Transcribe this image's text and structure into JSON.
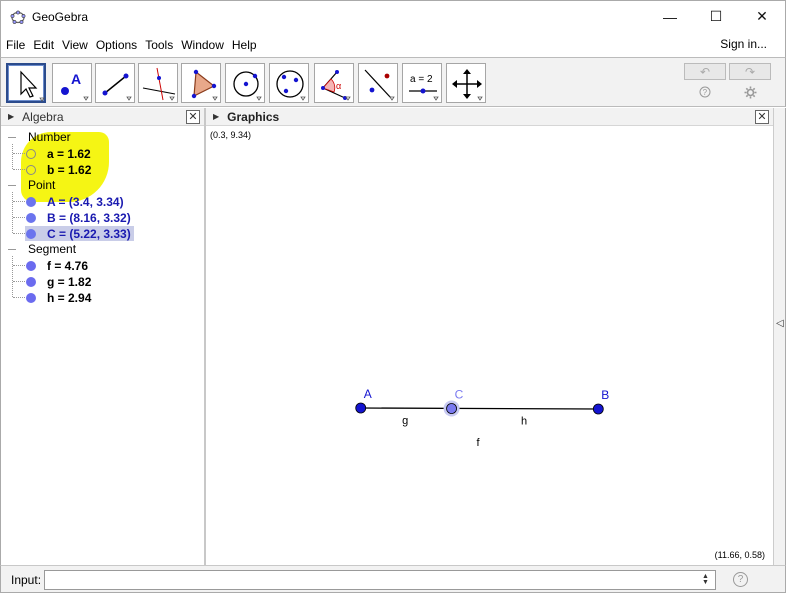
{
  "window": {
    "title": "GeoGebra",
    "minimize": "—",
    "maximize": "☐",
    "close": "✕"
  },
  "menu": {
    "items": [
      "File",
      "Edit",
      "View",
      "Options",
      "Tools",
      "Window",
      "Help"
    ],
    "signin": "Sign in..."
  },
  "toolbar": {
    "tools": [
      "move-tool",
      "point-tool",
      "segment-tool",
      "perpendicular-line-tool",
      "polygon-tool",
      "circle-center-point-tool",
      "circle-three-points-tool",
      "angle-tool",
      "reflect-tool",
      "slider-tool",
      "move-graphics-view-tool"
    ],
    "slider_label": "a = 2",
    "undo": "↶",
    "redo": "↷"
  },
  "algebra": {
    "title": "Algebra",
    "groups": [
      {
        "label": "Number",
        "items": [
          "a = 1.62",
          "b = 1.62"
        ]
      },
      {
        "label": "Point",
        "items": [
          "A = (3.4, 3.34)",
          "B = (8.16, 3.32)",
          "C = (5.22, 3.33)"
        ]
      },
      {
        "label": "Segment",
        "items": [
          "f = 4.76",
          "g = 1.82",
          "h = 2.94"
        ]
      }
    ]
  },
  "graphics": {
    "title": "Graphics",
    "corner_top_left": "(0.3, 9.34)",
    "corner_bottom_right": "(11.66, 0.58)",
    "points": [
      {
        "label": "A",
        "x": 3.4,
        "y": 3.34,
        "color": "#1414d0"
      },
      {
        "label": "C",
        "x": 5.22,
        "y": 3.33,
        "color": "#7a7af0"
      },
      {
        "label": "B",
        "x": 8.16,
        "y": 3.32,
        "color": "#1414d0"
      }
    ],
    "segment_labels": {
      "g": "g",
      "h": "h",
      "f": "f"
    }
  },
  "input": {
    "label": "Input:",
    "value": ""
  },
  "colors": {
    "point": "#1414d0",
    "selected_point": "#7a7af0",
    "highlight": "#f5f514",
    "selected_row": "#c9cde8"
  }
}
